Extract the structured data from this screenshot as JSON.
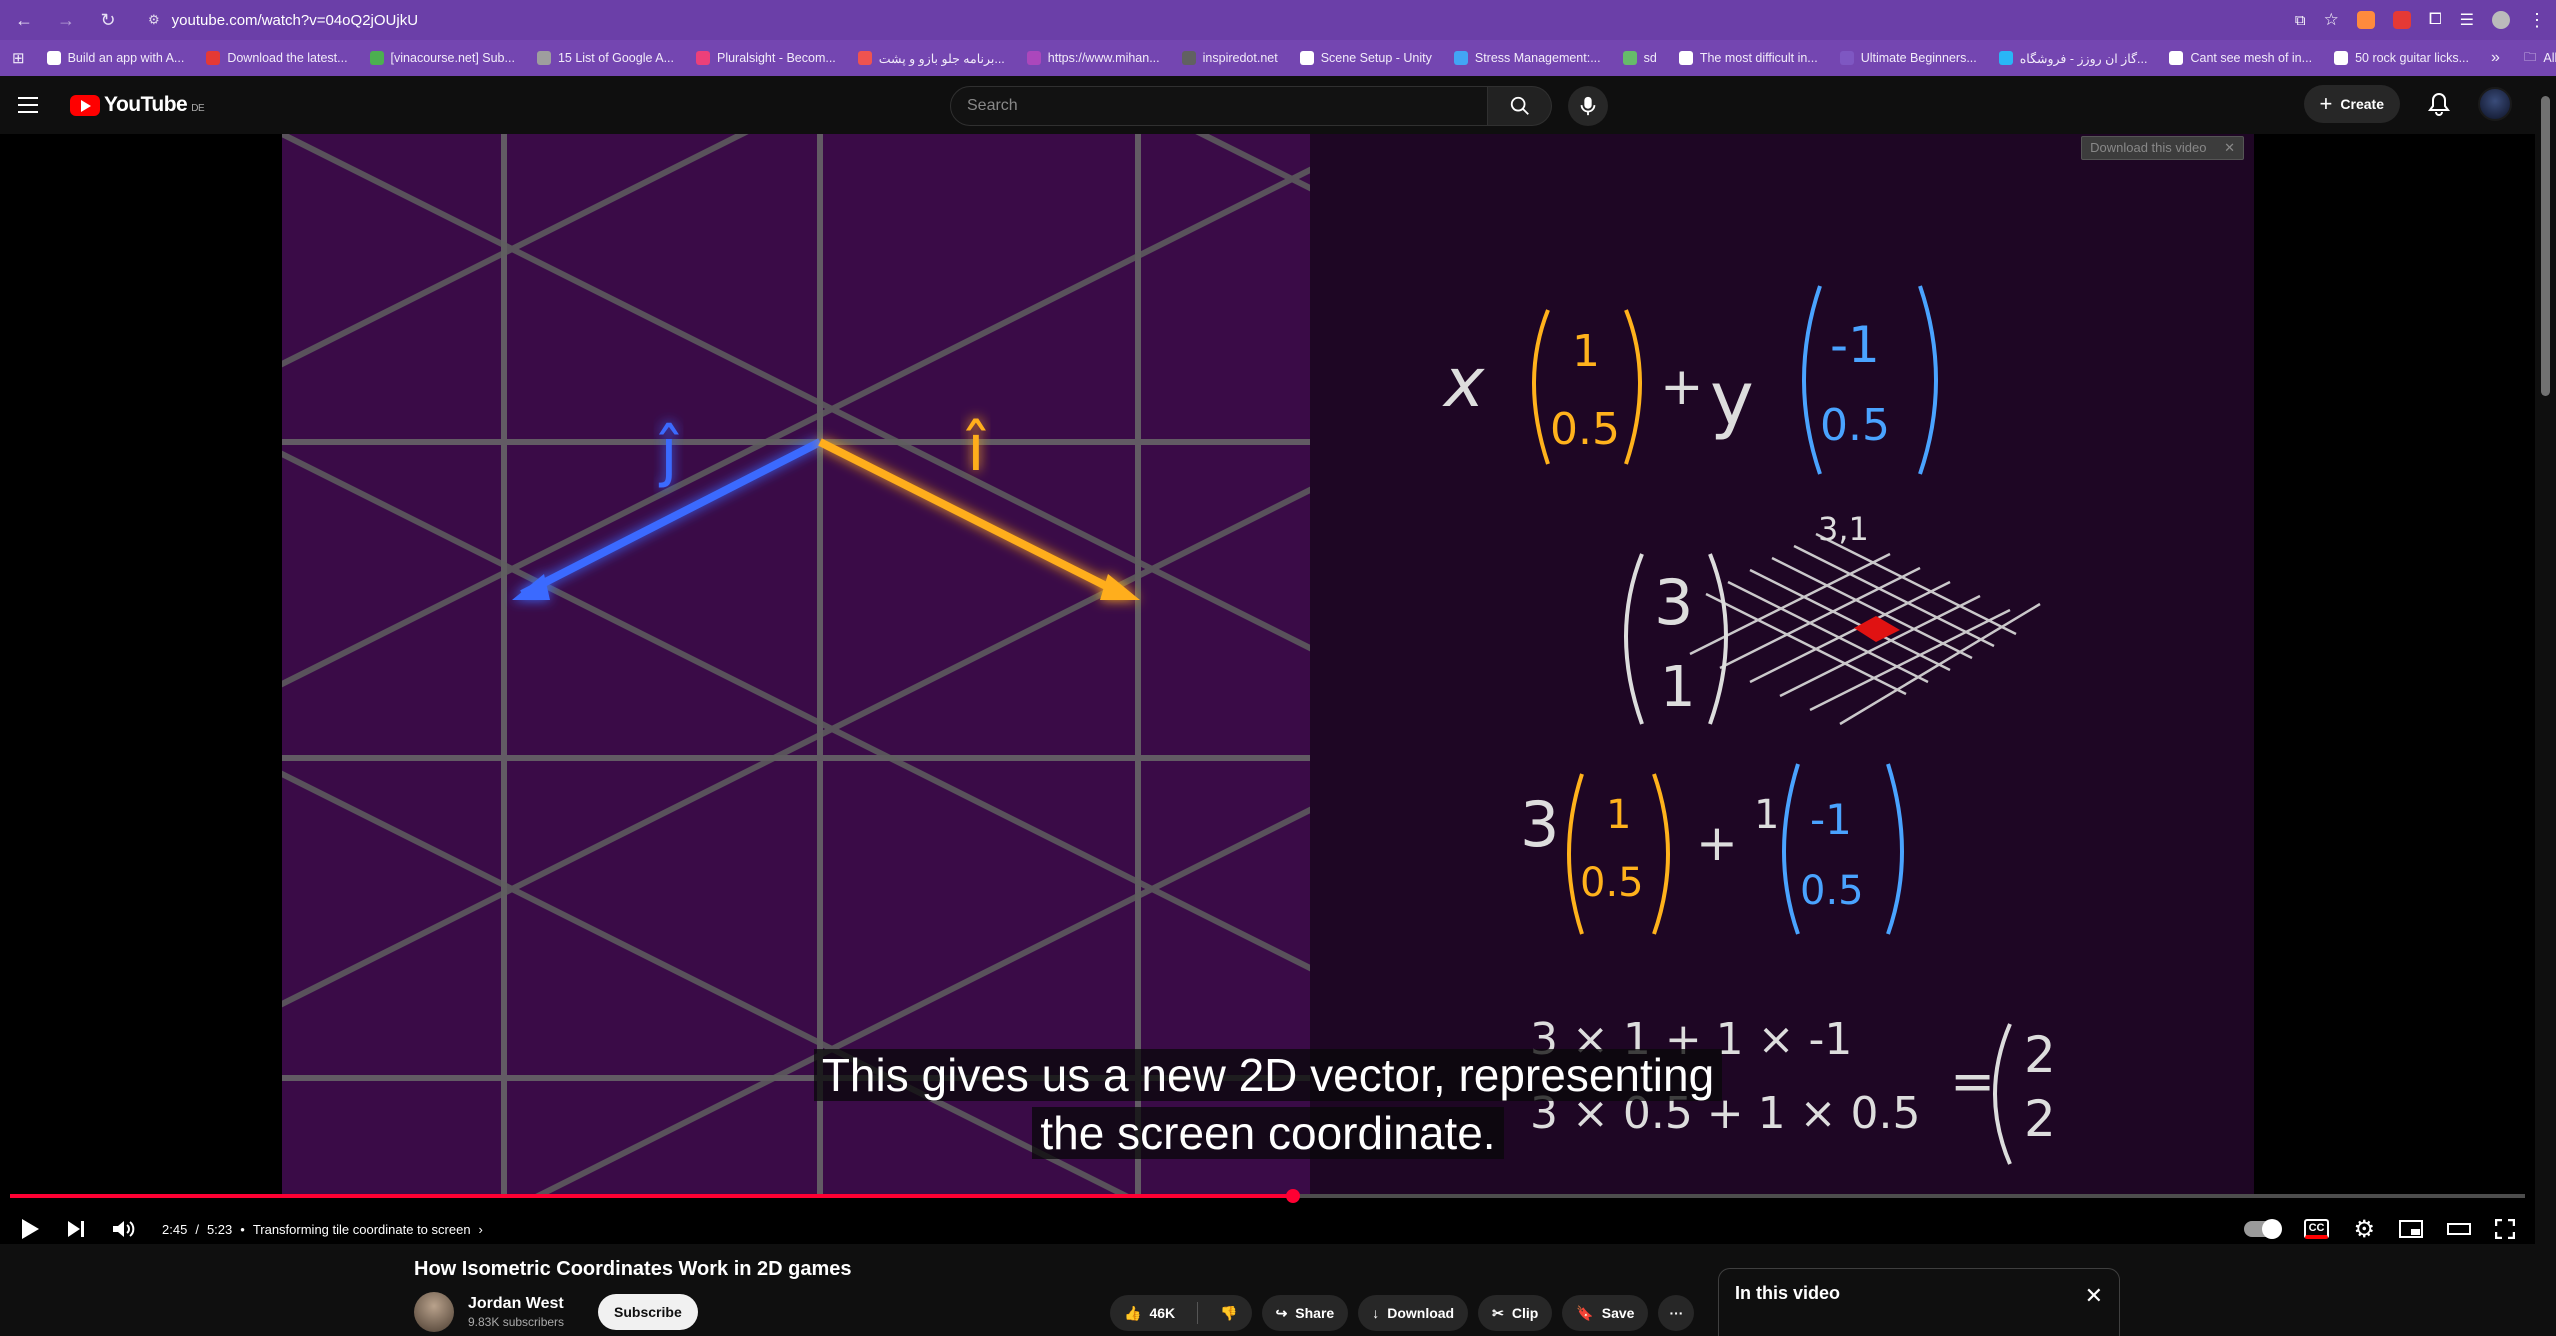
{
  "browser": {
    "url": "youtube.com/watch?v=04oQ2jOUjkU",
    "bookmarks": [
      {
        "label": "Build an app with A...",
        "color": "#ffffff"
      },
      {
        "label": "Download the latest...",
        "color": "#e53935"
      },
      {
        "label": "[vinacourse.net] Sub...",
        "color": "#4caf50"
      },
      {
        "label": "15 List of Google A...",
        "color": "#9e9e9e"
      },
      {
        "label": "Pluralsight - Becom...",
        "color": "#ec407a"
      },
      {
        "label": "برنامه جلو بازو و پشت...",
        "color": "#ef5350"
      },
      {
        "label": "https://www.mihan...",
        "color": "#ab47bc"
      },
      {
        "label": "inspiredot.net",
        "color": "#616161"
      },
      {
        "label": "Scene Setup - Unity",
        "color": "#ffffff"
      },
      {
        "label": "Stress Management:...",
        "color": "#42a5f5"
      },
      {
        "label": "sd",
        "color": "#66bb6a"
      },
      {
        "label": "The most difficult in...",
        "color": "#ffffff"
      },
      {
        "label": "Ultimate Beginners...",
        "color": "#7e57c2"
      },
      {
        "label": "گاز ان روزز - فروشگاه...",
        "color": "#29b6f6"
      },
      {
        "label": "Cant see mesh of in...",
        "color": "#ffffff"
      },
      {
        "label": "50 rock guitar licks...",
        "color": "#ffffff"
      }
    ],
    "more_label": "»",
    "all_bookmarks_label": "All Bookmarks"
  },
  "header": {
    "logo_text": "YouTube",
    "country_code": "DE",
    "search_placeholder": "Search",
    "create_label": "Create"
  },
  "player": {
    "download_overlay": "Download this video",
    "caption_line1": "This gives us a new 2D vector, representing",
    "caption_line2": "the screen coordinate.",
    "time_current": "2:45",
    "time_separator": "/",
    "time_total": "5:23",
    "chapter_title": "Transforming tile coordinate to screen",
    "progress": 0.51,
    "video": {
      "label_j": "ĵ",
      "label_i": "î",
      "eq1_x": "x",
      "eq1_a_top": "1",
      "eq1_a_bottom": "0.5",
      "eq1_plus": "+",
      "eq1_y": "y",
      "eq1_b_top": "-1",
      "eq1_b_bottom": "0.5",
      "coord_label": "3,1",
      "vec_top": "3",
      "vec_bottom": "1",
      "eq2_coef1": "3",
      "eq2_a_top": "1",
      "eq2_a_bottom": "0.5",
      "eq2_plus": "+",
      "eq2_coef2": "1",
      "eq2_b_top": "-1",
      "eq2_b_bottom": "0.5",
      "eq3_line1": "3 × 1   +  1 × -1",
      "eq3_line2": "3 × 0.5  +  1 × 0.5",
      "eq3_equals": "=",
      "eq3_result_top": "2",
      "eq3_result_bottom": "2"
    }
  },
  "video_info": {
    "title": "How Isometric Coordinates Work in 2D games",
    "channel_name": "Jordan West",
    "subscribers": "9.83K subscribers",
    "subscribe_label": "Subscribe",
    "likes": "46K",
    "share_label": "Share",
    "download_label": "Download",
    "clip_label": "Clip",
    "save_label": "Save",
    "more_label": "···",
    "panel_title": "In this video",
    "panel_close": "✕"
  }
}
